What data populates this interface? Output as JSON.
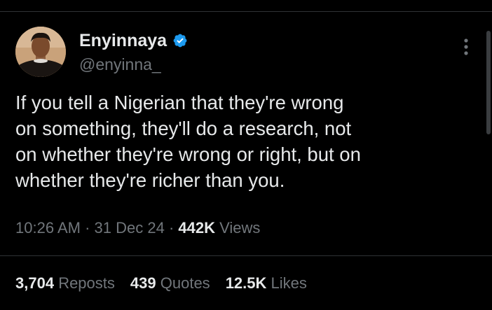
{
  "author": {
    "display_name": "Enyinnaya",
    "handle": "@enyinna_",
    "verified": true
  },
  "tweet": {
    "lines": [
      "If you tell a Nigerian that they're wrong",
      "on something, they'll do a research, not",
      "on whether they're wrong or right, but on",
      "whether they're richer than you."
    ]
  },
  "meta": {
    "time": "10:26 AM",
    "date": "31 Dec 24",
    "separator": "·",
    "views_count": "442K",
    "views_label": "Views"
  },
  "stats": {
    "reposts_count": "3,704",
    "reposts_label": "Reposts",
    "quotes_count": "439",
    "quotes_label": "Quotes",
    "likes_count": "12.5K",
    "likes_label": "Likes"
  },
  "icons": {
    "verified": "verified-badge-icon",
    "more": "more-options-icon"
  },
  "colors": {
    "background": "#000000",
    "primary_text": "#e7e9ea",
    "secondary_text": "#71767b",
    "verified_blue": "#1d9bf0",
    "divider": "#2f3336"
  }
}
